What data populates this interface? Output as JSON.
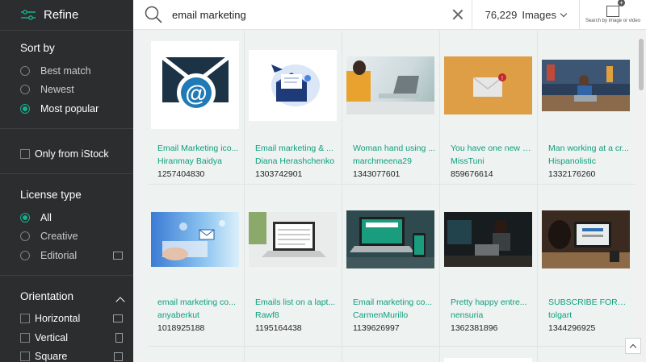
{
  "sidebar": {
    "title": "Refine",
    "sort": {
      "heading": "Sort by",
      "options": [
        "Best match",
        "Newest",
        "Most popular"
      ],
      "selected": "Most popular"
    },
    "only_istock": "Only from iStock",
    "license": {
      "heading": "License type",
      "options": [
        "All",
        "Creative",
        "Editorial"
      ],
      "selected": "All"
    },
    "orientation": {
      "heading": "Orientation",
      "options": [
        "Horizontal",
        "Vertical",
        "Square"
      ]
    }
  },
  "search": {
    "value": "email marketing",
    "result_count": "76,229",
    "result_type": "Images",
    "search_by_image": "Search by image or video"
  },
  "results": [
    {
      "title": "Email Marketing ico...",
      "author": "Hiranmay Baidya",
      "id": "1257404830"
    },
    {
      "title": "Email marketing & ...",
      "author": "Diana Herashchenko",
      "id": "1303742901"
    },
    {
      "title": "Woman hand using ...",
      "author": "marchmeena29",
      "id": "1343077601"
    },
    {
      "title": "You have one new e...",
      "author": "MissTuni",
      "id": "859676614"
    },
    {
      "title": "Man working at a cr...",
      "author": "Hispanolistic",
      "id": "1332176260"
    },
    {
      "title": "email marketing co...",
      "author": "anyaberkut",
      "id": "1018925188"
    },
    {
      "title": "Emails list on a lapt...",
      "author": "Rawf8",
      "id": "1195164438"
    },
    {
      "title": "Email marketing co...",
      "author": "CarmenMurillo",
      "id": "1139626997"
    },
    {
      "title": "Pretty happy entre...",
      "author": "nensuria",
      "id": "1362381896"
    },
    {
      "title": "SUBSCRIBE FORM ...",
      "author": "tolgart",
      "id": "1344296925"
    }
  ],
  "colors": {
    "accent": "#0d9f7e",
    "sidebar_bg": "#2b2d2e"
  }
}
